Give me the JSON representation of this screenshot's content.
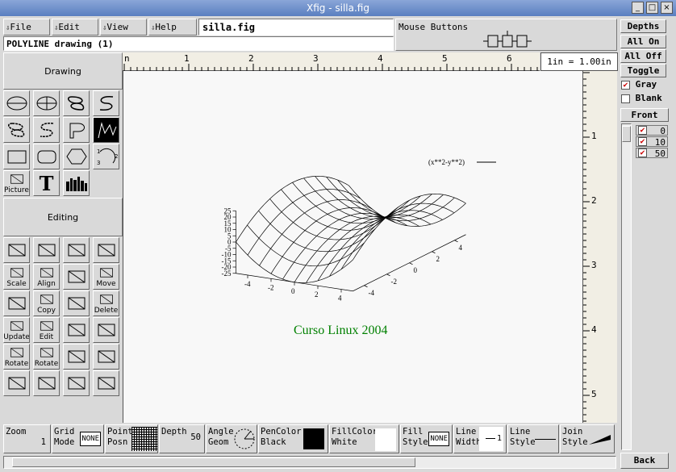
{
  "window": {
    "title": "Xfig - silla.fig",
    "buttons": [
      "_",
      "□",
      "×"
    ]
  },
  "menu": [
    {
      "label": "File"
    },
    {
      "label": "Edit"
    },
    {
      "label": "View"
    },
    {
      "label": "Help"
    }
  ],
  "file_name": "silla.fig",
  "message": "POLYLINE drawing   (1)",
  "mouse_buttons_label": "Mouse Buttons",
  "units": "1in = 1.00in",
  "panels": {
    "drawing": "Drawing",
    "editing": "Editing"
  },
  "drawing_tools": [
    {
      "name": "circle-radius"
    },
    {
      "name": "circle-diameter"
    },
    {
      "name": "closed-spline"
    },
    {
      "name": "open-spline"
    },
    {
      "name": "closed-approx-spline"
    },
    {
      "name": "approx-spline"
    },
    {
      "name": "polygon-arc"
    },
    {
      "name": "polyline",
      "selected": true
    },
    {
      "name": "rectangle"
    },
    {
      "name": "rounded-rectangle"
    },
    {
      "name": "regular-polygon"
    },
    {
      "name": "arc"
    },
    {
      "name": "picture",
      "label": "Picture"
    },
    {
      "name": "text",
      "label": "T"
    },
    {
      "name": "library"
    }
  ],
  "editing_tools": [
    {
      "name": "glue"
    },
    {
      "name": "break"
    },
    {
      "name": "open-compound"
    },
    {
      "name": "join-split"
    },
    {
      "name": "scale",
      "label": "Scale"
    },
    {
      "name": "align",
      "label": "Align"
    },
    {
      "name": "add-point"
    },
    {
      "name": "move",
      "label": "Move"
    },
    {
      "name": "move-point"
    },
    {
      "name": "copy",
      "label": "Copy"
    },
    {
      "name": "delete-point"
    },
    {
      "name": "delete",
      "label": "Delete"
    },
    {
      "name": "update",
      "label": "Update"
    },
    {
      "name": "edit",
      "label": "Edit"
    },
    {
      "name": "flip-vertical"
    },
    {
      "name": "flip-horizontal"
    },
    {
      "name": "rotate-cw",
      "label": "Rotate"
    },
    {
      "name": "rotate-ccw",
      "label": "Rotate"
    },
    {
      "name": "convert"
    },
    {
      "name": "anchor"
    },
    {
      "name": "tangent"
    },
    {
      "name": "arrow-mode"
    },
    {
      "name": "round-corner"
    },
    {
      "name": "measure"
    }
  ],
  "ruler_h": [
    "1",
    "2",
    "3",
    "4",
    "5",
    "6"
  ],
  "ruler_v": [
    "1",
    "2",
    "3",
    "4",
    "5"
  ],
  "depths": {
    "title": "Depths",
    "all_on": "All On",
    "all_off": "All Off",
    "toggle": "Toggle",
    "gray": "Gray",
    "blank": "Blank",
    "front": "Front",
    "back": "Back",
    "levels": [
      "0",
      "10",
      "50"
    ]
  },
  "figure": {
    "legend": "(x**2-y**2)",
    "caption": "Curso Linux 2004",
    "caption_color": "#008000",
    "z_ticks": [
      "25",
      "20",
      "15",
      "10",
      "5",
      "0",
      "-5",
      "-10",
      "-15",
      "-20",
      "-25"
    ],
    "x_ticks": [
      "-4",
      "-2",
      "0",
      "2",
      "4"
    ],
    "y_ticks": [
      "-4",
      "-2",
      "0",
      "2",
      "4"
    ]
  },
  "bottom": {
    "zoom_label": "Zoom",
    "zoom_value": "1",
    "grid_label1": "Grid",
    "grid_label2": "Mode",
    "grid_value": "NONE",
    "point_label1": "Point",
    "point_label2": "Posn",
    "depth_label": "Depth",
    "depth_value": "50",
    "angle_label1": "Angle",
    "angle_label2": "Geom",
    "pencolor_label": "PenColor",
    "pencolor_value": "Black",
    "fillcolor_label": "FillColor",
    "fillcolor_value": "White",
    "fill_label1": "Fill",
    "fill_label2": "Style",
    "fill_value": "NONE",
    "line_label1": "Line",
    "line_label2": "Width",
    "line_width": "1",
    "linestyle_label1": "Line",
    "linestyle_label2": "Style",
    "join_label1": "Join",
    "join_label2": "Style"
  }
}
